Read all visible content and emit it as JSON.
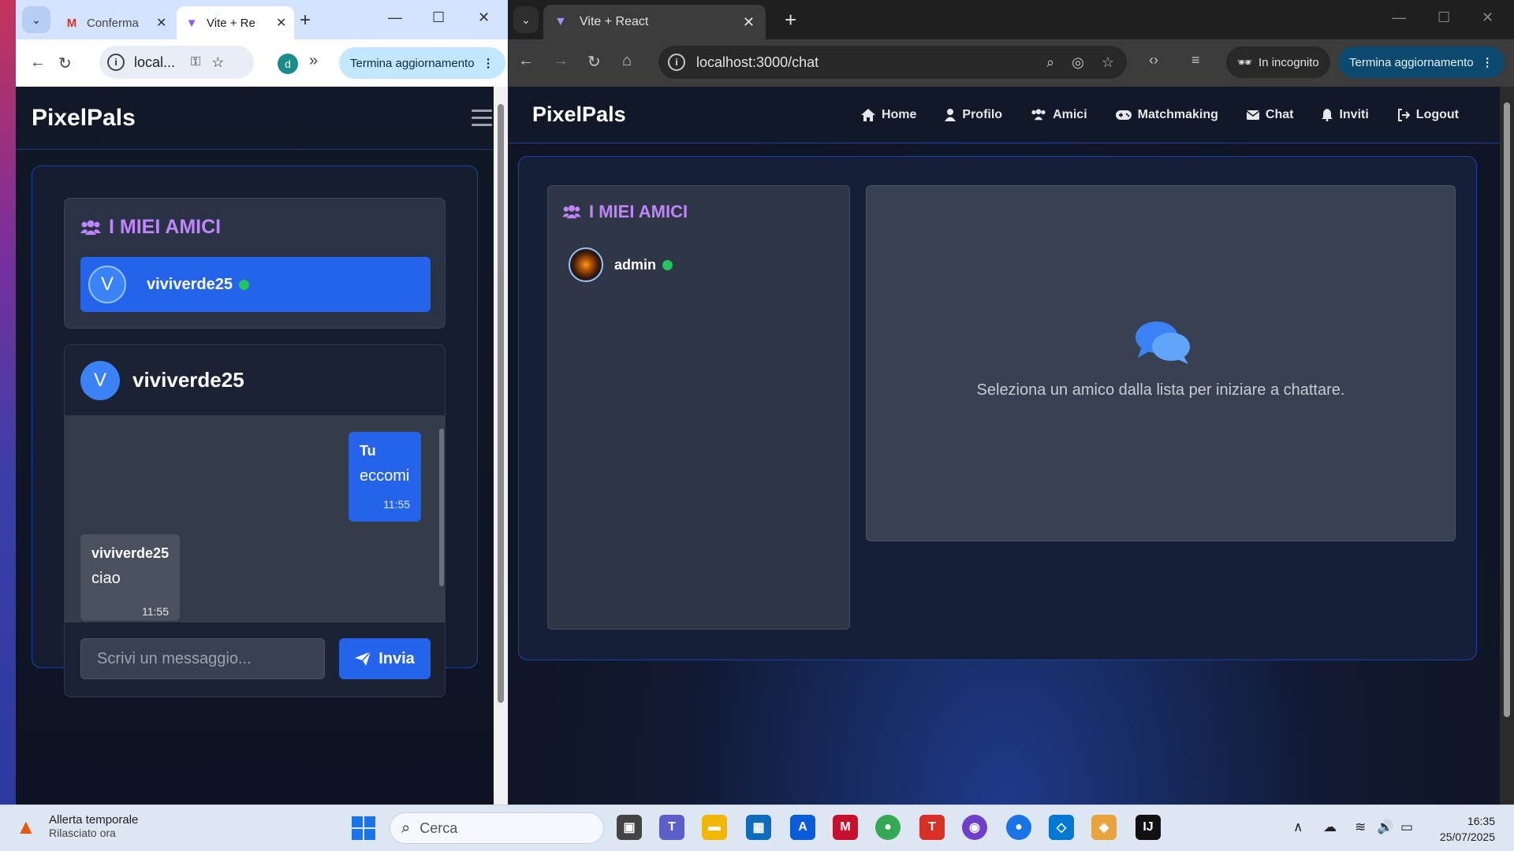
{
  "left_window": {
    "tabs": [
      {
        "title": "Conferma",
        "icon": "gmail-icon"
      },
      {
        "title": "Vite + Re",
        "icon": "vite-icon"
      }
    ],
    "address": "local...",
    "profile_initial": "d",
    "update_button": "Termina aggiornamento",
    "app": {
      "brand": "PixelPals",
      "friends_title": "I MIEI AMICI",
      "selected_friend": {
        "initial": "V",
        "name": "viviverde25",
        "online": true
      },
      "chat": {
        "header_initial": "V",
        "header_name": "viviverde25",
        "messages": [
          {
            "sender": "Tu",
            "text": "eccomi",
            "time": "11:55",
            "mine": true
          },
          {
            "sender": "viviverde25",
            "text": "ciao",
            "time": "11:55",
            "mine": false
          }
        ],
        "input_placeholder": "Scrivi un messaggio...",
        "send_label": "Invia"
      }
    }
  },
  "right_window": {
    "tab_title": "Vite + React",
    "address": "localhost:3000/chat",
    "incognito_label": "In incognito",
    "update_button": "Termina aggiornamento",
    "app": {
      "brand": "PixelPals",
      "nav": [
        {
          "label": "Home",
          "icon": "home-icon"
        },
        {
          "label": "Profilo",
          "icon": "user-icon"
        },
        {
          "label": "Amici",
          "icon": "users-icon"
        },
        {
          "label": "Matchmaking",
          "icon": "gamepad-icon"
        },
        {
          "label": "Chat",
          "icon": "envelope-icon"
        },
        {
          "label": "Inviti",
          "icon": "bell-icon"
        },
        {
          "label": "Logout",
          "icon": "logout-icon"
        }
      ],
      "friends_title": "I MIEI AMICI",
      "friends": [
        {
          "name": "admin",
          "online": true
        }
      ],
      "empty_message": "Seleziona un amico dalla lista per iniziare a chattare."
    }
  },
  "taskbar": {
    "weather_title": "Allerta temporale",
    "weather_subtitle": "Rilasciato ora",
    "search_placeholder": "Cerca",
    "time": "16:35",
    "date": "25/07/2025"
  },
  "colors": {
    "accent_blue": "#2563eb",
    "title_purple": "#c084fc",
    "online_green": "#22c55e"
  }
}
